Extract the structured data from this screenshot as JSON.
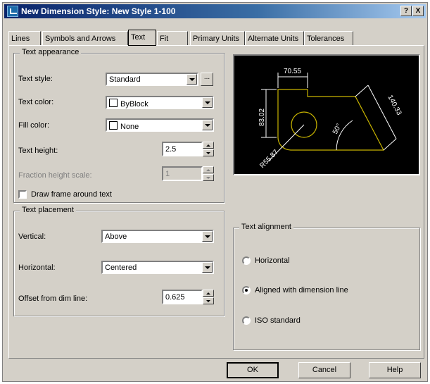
{
  "window": {
    "title": "New Dimension Style: New Style 1-100",
    "help_label": "?",
    "close_label": "X"
  },
  "tabs": [
    {
      "label": "Lines",
      "active": false
    },
    {
      "label": "Symbols and Arrows",
      "active": false
    },
    {
      "label": "Text",
      "active": true
    },
    {
      "label": "Fit",
      "active": false
    },
    {
      "label": "Primary Units",
      "active": false
    },
    {
      "label": "Alternate Units",
      "active": false
    },
    {
      "label": "Tolerances",
      "active": false
    }
  ],
  "text_appearance": {
    "legend": "Text appearance",
    "text_style": {
      "label": "Text style:",
      "value": "Standard",
      "browse_label": "..."
    },
    "text_color": {
      "label": "Text color:",
      "value": "ByBlock"
    },
    "fill_color": {
      "label": "Fill color:",
      "value": "None"
    },
    "text_height": {
      "label": "Text height:",
      "value": "2.5"
    },
    "fraction_height_scale": {
      "label": "Fraction height scale:",
      "value": "1"
    },
    "draw_frame": {
      "label": "Draw frame around text",
      "checked": false
    }
  },
  "text_placement": {
    "legend": "Text placement",
    "vertical": {
      "label": "Vertical:",
      "value": "Above"
    },
    "horizontal": {
      "label": "Horizontal:",
      "value": "Centered"
    },
    "offset": {
      "label": "Offset from dim line:",
      "value": "0.625"
    }
  },
  "text_alignment": {
    "legend": "Text alignment",
    "options": [
      {
        "label": "Horizontal",
        "selected": false
      },
      {
        "label": "Aligned with dimension line",
        "selected": true
      },
      {
        "label": "ISO standard",
        "selected": false
      }
    ]
  },
  "preview": {
    "dim_top": "70.55",
    "dim_left": "83.02",
    "dim_right": "140.33",
    "dim_angle": "50°",
    "dim_radius": "R55.87",
    "line_color": "#ffffff",
    "shape_color": "#c8b400"
  },
  "buttons": {
    "ok": "OK",
    "cancel": "Cancel",
    "help": "Help"
  }
}
